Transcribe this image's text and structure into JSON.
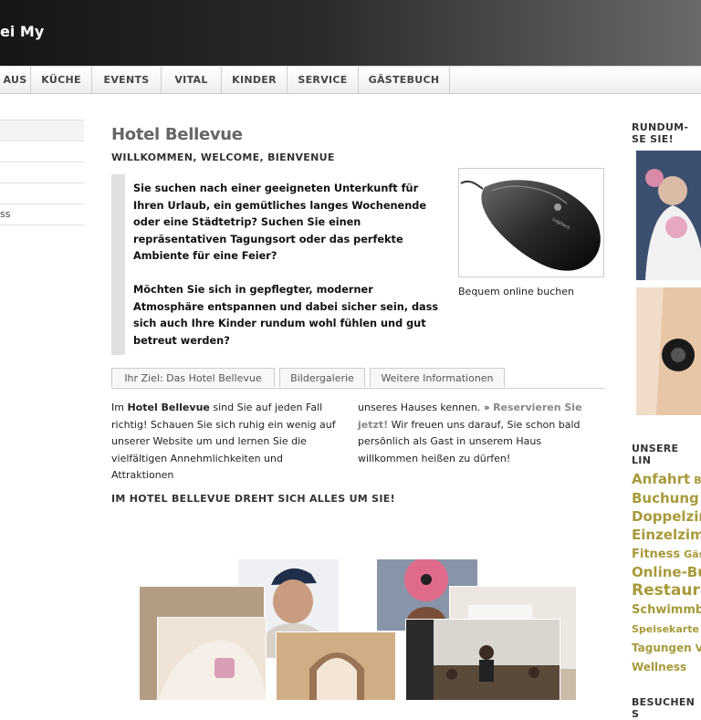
{
  "header": {
    "title": "ei My"
  },
  "nav": {
    "items": [
      {
        "label": "AUS",
        "w": 34
      },
      {
        "label": "KÜCHE",
        "w": 67
      },
      {
        "label": "EVENTS",
        "w": 76
      },
      {
        "label": "VITAL",
        "w": 66
      },
      {
        "label": "KINDER",
        "w": 72
      },
      {
        "label": "SERVICE",
        "w": 78
      },
      {
        "label": "GÄSTEBUCH",
        "w": 100
      }
    ]
  },
  "left_nav": {
    "items": [
      "",
      "",
      "",
      "",
      "ss"
    ]
  },
  "main": {
    "title": "Hotel Bellevue",
    "subtitle": "WILLKOMMEN, WELCOME, BIENVENUE",
    "quote_p1": "Sie suchen nach einer geeigneten Unterkunft für Ihren Urlaub, ein gemütliches langes Wochenende oder eine Städtetrip? Suchen Sie einen repräsentativen Tagungsort oder das perfekte Ambiente für eine Feier?",
    "quote_p2": "Möchten Sie sich in gepflegter, moderner Atmosphäre entspannen und dabei sicher sein, dass sich auch Ihre Kinder rundum wohl fühlen und gut betreut werden?",
    "image_caption": "Bequem online buchen",
    "tabs": [
      "Ihr Ziel: Das Hotel Bellevue",
      "Bildergalerie",
      "Weitere Informationen"
    ],
    "col1_pre": "Im ",
    "col1_bold": "Hotel Bellevue",
    "col1_post": " sind Sie auf jeden Fall richtig! Schauen Sie sich ruhig ein wenig auf unserer Website um und lernen Sie die vielfältigen Annehmlichkeiten und Attraktionen",
    "col2_pre": "unseres Hauses kennen. » ",
    "col2_link": "Reservieren Sie jetzt!",
    "col2_post": " Wir freuen uns darauf, Sie schon bald persönlich als Gast in unserem Haus willkommen heißen zu dürfen!",
    "section_heading": "IM HOTEL BELLEVUE DREHT SICH ALLES UM SIE!"
  },
  "right": {
    "heading1": "RUNDUM-SE SIE!",
    "heading2": "UNSERE LIN",
    "tags": [
      {
        "text": "Anfahrt",
        "size": 15,
        "suffix": "Ba"
      },
      {
        "text": "Buchung (",
        "size": 15,
        "suffix": ""
      },
      {
        "text": "Doppelzir",
        "size": 15,
        "suffix": ""
      },
      {
        "text": "Einzelzimr",
        "size": 15,
        "suffix": ""
      },
      {
        "text": "Fitness",
        "size": 13,
        "suffix": "Gäst"
      },
      {
        "text": "Online-Bu",
        "size": 15,
        "suffix": ""
      },
      {
        "text": "Restaura",
        "size": 17,
        "suffix": ""
      },
      {
        "text": "Schwimmb",
        "size": 13,
        "suffix": ""
      },
      {
        "text": "Speisekarte",
        "size": 11,
        "suffix": "S"
      },
      {
        "text": "Tagungen",
        "size": 12,
        "suffix": "V"
      },
      {
        "text": "Wellness",
        "size": 12,
        "suffix": ""
      }
    ],
    "heading3": "BESUCHEN S"
  },
  "colors": {
    "accent": "#a89a3a",
    "link": "#888888"
  }
}
